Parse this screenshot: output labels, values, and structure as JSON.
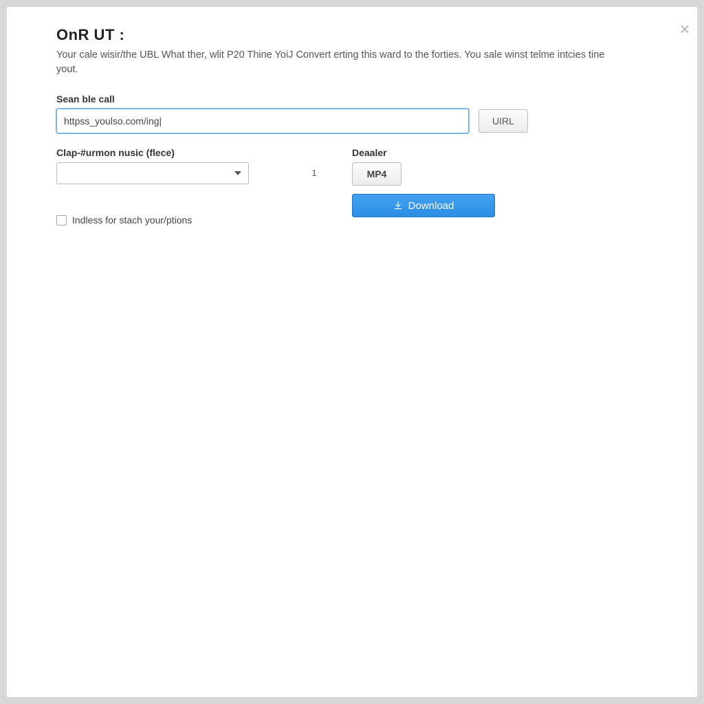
{
  "header": {
    "title": "OnR UT :",
    "description": "Your cale wisir/the UBL What ther, wlit P20 Thine YoiJ Convert erting this ward to the forties. You sale winst telme intcies tine yout."
  },
  "url_section": {
    "label": "Sean ble call",
    "input_value": "httpss_youlso.com/ing|",
    "button_label": "UIRL"
  },
  "format_section": {
    "label": "Clap-#urmon nusic (flece)",
    "select_value": "",
    "mid_marker": "1"
  },
  "dealer_section": {
    "label": "Deaaler",
    "format_button": "MP4",
    "download_button": "Download"
  },
  "checkbox": {
    "label": "Indless for stach your/ptions",
    "checked": false
  }
}
